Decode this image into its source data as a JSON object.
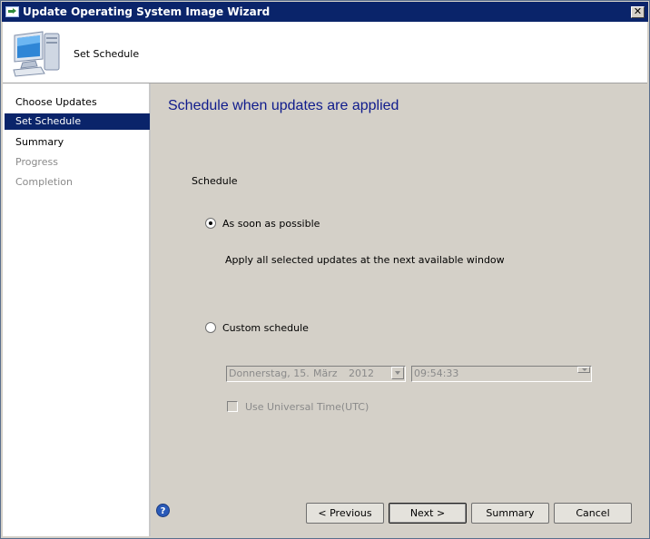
{
  "window": {
    "title": "Update Operating System Image Wizard",
    "close_glyph": "✕"
  },
  "header": {
    "title": "Set Schedule",
    "icon": "computer-monitor-icon"
  },
  "sidebar": {
    "items": [
      {
        "label": "Choose Updates",
        "state": "normal"
      },
      {
        "label": "Set Schedule",
        "state": "active"
      },
      {
        "label": "Summary",
        "state": "normal"
      },
      {
        "label": "Progress",
        "state": "disabled"
      },
      {
        "label": "Completion",
        "state": "disabled"
      }
    ]
  },
  "content": {
    "title": "Schedule when updates are applied",
    "schedule_label": "Schedule",
    "option_asap": {
      "label": "As soon as possible",
      "checked": true
    },
    "asap_description": "Apply all selected updates at the next available window",
    "option_custom": {
      "label": "Custom schedule",
      "checked": false
    },
    "date_field": {
      "weekday_day": "Donnerstag, 15.",
      "month": "März",
      "year": "2012"
    },
    "time_field": {
      "value": "09:54:33"
    },
    "utc_checkbox": {
      "label": "Use Universal Time(UTC)",
      "checked": false
    }
  },
  "footer": {
    "help_glyph": "?",
    "previous_label": "< Previous",
    "next_label": "Next >",
    "summary_label": "Summary",
    "cancel_label": "Cancel"
  }
}
